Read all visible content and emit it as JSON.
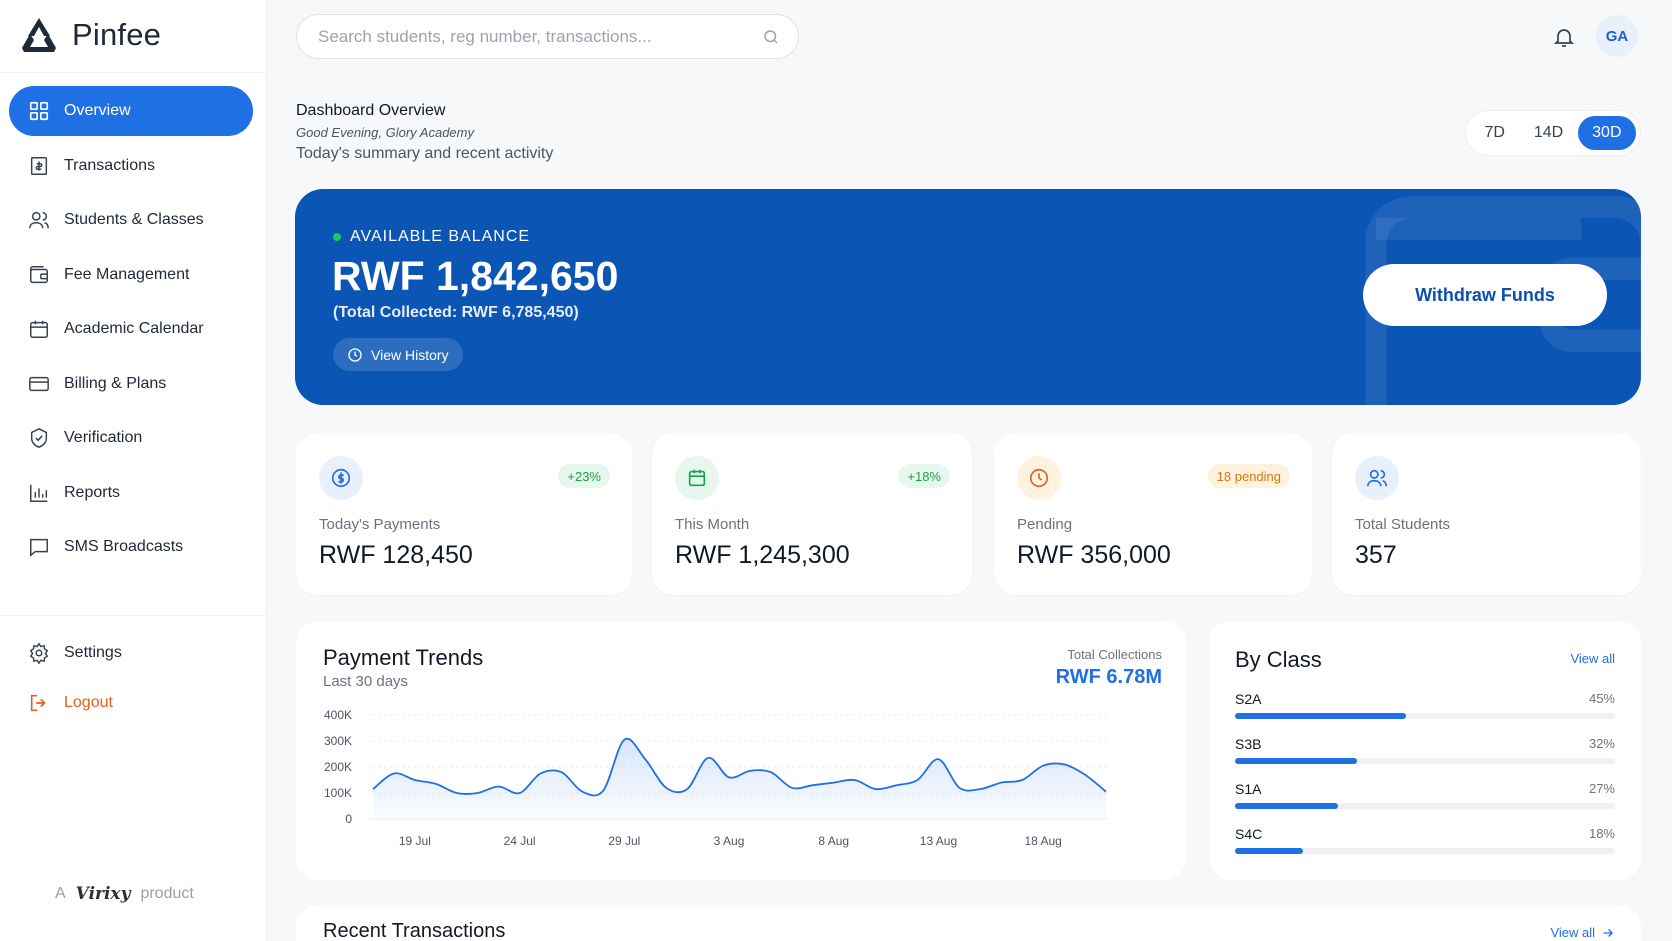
{
  "brand": {
    "name": "Pinfee",
    "footer_prefix": "A",
    "footer_logo": "Virixy",
    "footer_suffix": "product"
  },
  "sidebar": {
    "items": [
      {
        "label": "Overview",
        "icon": "grid-icon",
        "active": true
      },
      {
        "label": "Transactions",
        "icon": "receipt-icon"
      },
      {
        "label": "Students & Classes",
        "icon": "users-icon"
      },
      {
        "label": "Fee Management",
        "icon": "wallet-icon"
      },
      {
        "label": "Academic Calendar",
        "icon": "calendar-icon"
      },
      {
        "label": "Billing & Plans",
        "icon": "credit-card-icon"
      },
      {
        "label": "Verification",
        "icon": "shield-check-icon"
      },
      {
        "label": "Reports",
        "icon": "bar-chart-icon"
      },
      {
        "label": "SMS Broadcasts",
        "icon": "message-icon"
      }
    ],
    "bottom": [
      {
        "label": "Settings",
        "icon": "gear-icon"
      },
      {
        "label": "Logout",
        "icon": "logout-icon"
      }
    ]
  },
  "header": {
    "search_placeholder": "Search students, reg number, transactions...",
    "avatar": "GA"
  },
  "heading": {
    "title": "Dashboard Overview",
    "greeting": "Good Evening, Glory Academy",
    "subtitle": "Today's summary and recent activity"
  },
  "range": {
    "options": [
      "7D",
      "14D",
      "30D"
    ],
    "selected": "30D"
  },
  "balance": {
    "label": "AVAILABLE BALANCE",
    "amount": "RWF 1,842,650",
    "total": "(Total Collected: RWF 6,785,450)",
    "history": "View History",
    "withdraw": "Withdraw Funds"
  },
  "stats": [
    {
      "label": "Today's Payments",
      "value": "RWF 128,450",
      "badge": "+23%",
      "icon": "dollar-icon"
    },
    {
      "label": "This Month",
      "value": "RWF 1,245,300",
      "badge": "+18%",
      "icon": "calendar-icon"
    },
    {
      "label": "Pending",
      "value": "RWF 356,000",
      "badge": "18 pending",
      "icon": "clock-icon"
    },
    {
      "label": "Total Students",
      "value": "357",
      "icon": "users-icon"
    }
  ],
  "trend": {
    "title": "Payment Trends",
    "subtitle": "Last 30 days",
    "total_label": "Total Collections",
    "total_value": "RWF 6.78M"
  },
  "chart_data": {
    "type": "area",
    "title": "Payment Trends",
    "x": [
      "17 Jul",
      "18 Jul",
      "19 Jul",
      "20 Jul",
      "21 Jul",
      "22 Jul",
      "23 Jul",
      "24 Jul",
      "25 Jul",
      "26 Jul",
      "27 Jul",
      "28 Jul",
      "29 Jul",
      "30 Jul",
      "31 Jul",
      "1 Aug",
      "2 Aug",
      "3 Aug",
      "4 Aug",
      "5 Aug",
      "6 Aug",
      "7 Aug",
      "8 Aug",
      "9 Aug",
      "10 Aug",
      "11 Aug",
      "12 Aug",
      "13 Aug",
      "14 Aug",
      "15 Aug",
      "16 Aug",
      "17 Aug",
      "18 Aug",
      "19 Aug",
      "20 Aug"
    ],
    "values": [
      115000,
      175000,
      150000,
      135000,
      100000,
      100000,
      125000,
      100000,
      175000,
      180000,
      105000,
      110000,
      305000,
      230000,
      120000,
      115000,
      235000,
      160000,
      185000,
      180000,
      120000,
      130000,
      140000,
      150000,
      115000,
      130000,
      150000,
      230000,
      120000,
      115000,
      140000,
      150000,
      205000,
      210000,
      170000,
      105000
    ],
    "xticks": [
      "19 Jul",
      "24 Jul",
      "29 Jul",
      "3 Aug",
      "8 Aug",
      "13 Aug",
      "18 Aug"
    ],
    "yticks": [
      "0",
      "100K",
      "200K",
      "300K",
      "400K"
    ],
    "ylim": [
      0,
      400000
    ]
  },
  "by_class": {
    "title": "By Class",
    "view_all": "View all",
    "rows": [
      {
        "label": "S2A",
        "pct": "45%",
        "value": 0.45
      },
      {
        "label": "S3B",
        "pct": "32%",
        "value": 0.32
      },
      {
        "label": "S1A",
        "pct": "27%",
        "value": 0.27
      },
      {
        "label": "S4C",
        "pct": "18%",
        "value": 0.18
      }
    ]
  },
  "recent": {
    "title": "Recent Transactions",
    "view_all": "View all"
  },
  "colors": {
    "primary": "#1f6fe5",
    "balance_bg": "#0b55b5",
    "logout": "#e2611b"
  }
}
